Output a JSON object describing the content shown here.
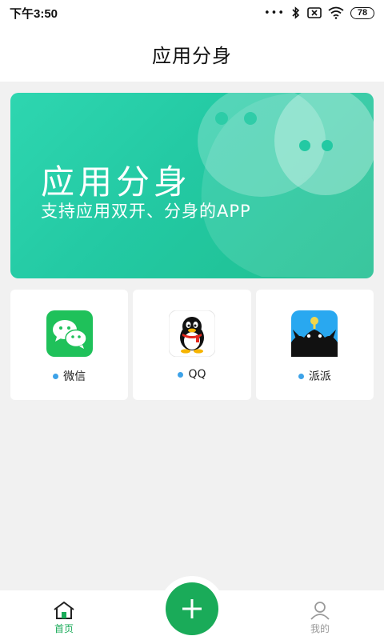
{
  "status_bar": {
    "time": "下午3:50",
    "signal_dots": "•••",
    "battery": "78",
    "icons": [
      "bluetooth-icon",
      "sim-x-icon",
      "wifi-icon",
      "battery-icon"
    ]
  },
  "header": {
    "title": "应用分身"
  },
  "banner": {
    "title": "应用分身",
    "subtitle": "支持应用双开、分身的APP"
  },
  "apps": [
    {
      "label": "微信",
      "icon": "wechat-icon"
    },
    {
      "label": "QQ",
      "icon": "qq-icon"
    },
    {
      "label": "派派",
      "icon": "paipai-icon"
    }
  ],
  "bottom_nav": {
    "home_label": "首页",
    "mine_label": "我的",
    "add_icon": "plus-icon"
  },
  "colors": {
    "accent_green": "#1aab59",
    "banner_teal": "#23c9a3",
    "dot_blue": "#3da2e8"
  }
}
